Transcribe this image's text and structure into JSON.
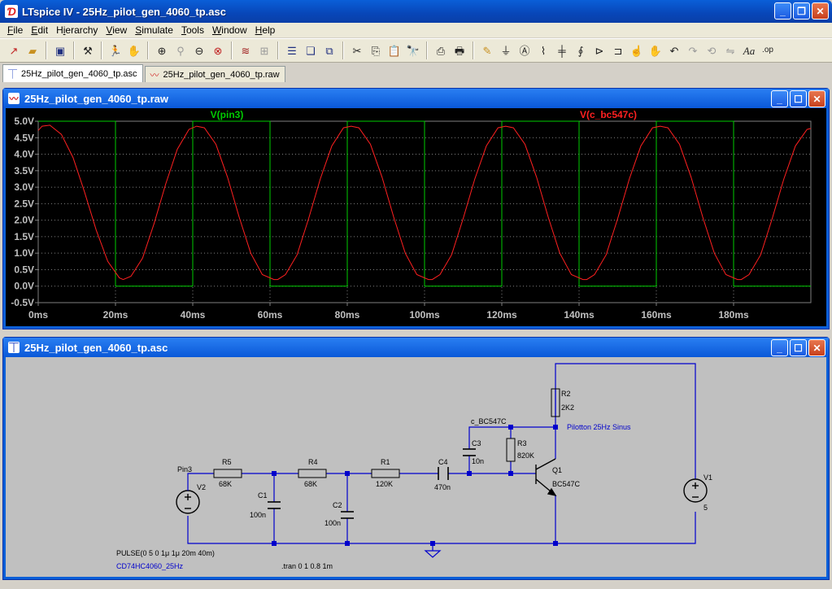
{
  "window": {
    "title": "LTspice IV - 25Hz_pilot_gen_4060_tp.asc",
    "icon": "ltspice-logo-icon"
  },
  "menu": [
    "File",
    "Edit",
    "Hierarchy",
    "View",
    "Simulate",
    "Tools",
    "Window",
    "Help"
  ],
  "toolbar": {
    "groups": [
      [
        "new-schematic-icon",
        "open-icon"
      ],
      [
        "save-icon"
      ],
      [
        "control-panel-icon"
      ],
      [
        "run-icon",
        "halt-icon"
      ],
      [
        "zoom-in-icon",
        "zoom-pan-icon",
        "zoom-out-icon",
        "zoom-fit-icon"
      ],
      [
        "autorange-icon",
        "grid-icon"
      ],
      [
        "tile-horizontal-icon",
        "cascade-icon",
        "tile-vertical-icon"
      ],
      [
        "cut-icon",
        "copy-icon",
        "paste-icon",
        "find-icon"
      ],
      [
        "print-setup-icon",
        "print-icon"
      ],
      [
        "wire-icon",
        "ground-icon",
        "label-icon",
        "resistor-icon",
        "capacitor-icon",
        "inductor-icon",
        "diode-icon",
        "component-icon",
        "move-icon",
        "drag-icon",
        "undo-icon",
        "redo-icon",
        "rotate-icon",
        "mirror-icon",
        "text-icon",
        "spice-directive-icon"
      ]
    ]
  },
  "tabs": [
    {
      "label": "25Hz_pilot_gen_4060_tp.asc",
      "icon": "schematic-icon",
      "active": true
    },
    {
      "label": "25Hz_pilot_gen_4060_tp.raw",
      "icon": "waveform-icon",
      "active": false
    }
  ],
  "wave_window": {
    "title": "25Hz_pilot_gen_4060_tp.raw"
  },
  "sch_window": {
    "title": "25Hz_pilot_gen_4060_tp.asc"
  },
  "chart_data": {
    "type": "line",
    "xlabel": "",
    "ylabel": "",
    "xlim": [
      0,
      200
    ],
    "ylim": [
      -0.5,
      5.0
    ],
    "x_ticks": [
      "0ms",
      "20ms",
      "40ms",
      "60ms",
      "80ms",
      "100ms",
      "120ms",
      "140ms",
      "160ms",
      "180ms"
    ],
    "x_tick_values": [
      0,
      20,
      40,
      60,
      80,
      100,
      120,
      140,
      160,
      180
    ],
    "y_ticks": [
      "5.0V",
      "4.5V",
      "4.0V",
      "3.5V",
      "3.0V",
      "2.5V",
      "2.0V",
      "1.5V",
      "1.0V",
      "0.5V",
      "0.0V",
      "-0.5V"
    ],
    "y_tick_values": [
      5.0,
      4.5,
      4.0,
      3.5,
      3.0,
      2.5,
      2.0,
      1.5,
      1.0,
      0.5,
      0.0,
      -0.5
    ],
    "grid": true,
    "background": "#000000",
    "grid_color": "#808080",
    "series": [
      {
        "name": "V(pin3)",
        "color": "#00cc00",
        "x": [
          0,
          20,
          20,
          40,
          40,
          60,
          60,
          80,
          80,
          100,
          100,
          120,
          120,
          140,
          140,
          160,
          160,
          180,
          180,
          200
        ],
        "y": [
          5,
          5,
          0,
          0,
          5,
          5,
          0,
          0,
          5,
          5,
          0,
          0,
          5,
          5,
          0,
          0,
          5,
          5,
          0,
          0
        ]
      },
      {
        "name": "V(c_bc547c)",
        "color": "#ff2020",
        "x": [
          0,
          1,
          3,
          6,
          9,
          12,
          15,
          18,
          21,
          22,
          24,
          27,
          30,
          33,
          36,
          39,
          41,
          43,
          46,
          49,
          52,
          55,
          58,
          61,
          62,
          64,
          67,
          70,
          73,
          76,
          79,
          81,
          83,
          86,
          89,
          92,
          95,
          98,
          101,
          102,
          104,
          107,
          110,
          113,
          116,
          119,
          121,
          123,
          126,
          129,
          132,
          135,
          138,
          141,
          142,
          144,
          147,
          150,
          153,
          156,
          159,
          161,
          163,
          166,
          169,
          172,
          175,
          178,
          181,
          182,
          184,
          187,
          190,
          193,
          196,
          199,
          200
        ],
        "y": [
          4.72,
          4.85,
          4.88,
          4.6,
          3.9,
          2.85,
          1.7,
          0.75,
          0.25,
          0.2,
          0.3,
          0.85,
          1.9,
          3.1,
          4.15,
          4.75,
          4.85,
          4.8,
          4.3,
          3.3,
          2.1,
          1.0,
          0.35,
          0.2,
          0.2,
          0.35,
          0.95,
          2.05,
          3.25,
          4.25,
          4.8,
          4.85,
          4.8,
          4.3,
          3.3,
          2.1,
          1.0,
          0.35,
          0.2,
          0.2,
          0.35,
          0.95,
          2.05,
          3.25,
          4.25,
          4.8,
          4.85,
          4.8,
          4.3,
          3.3,
          2.1,
          1.0,
          0.35,
          0.2,
          0.2,
          0.35,
          0.95,
          2.05,
          3.25,
          4.25,
          4.8,
          4.85,
          4.8,
          4.3,
          3.3,
          2.1,
          1.0,
          0.35,
          0.2,
          0.2,
          0.35,
          0.95,
          2.05,
          3.25,
          4.25,
          4.75,
          4.78
        ]
      }
    ]
  },
  "schematic": {
    "wire_color": "#0000cc",
    "flag_color": "#000000",
    "components": [
      {
        "ref": "R5",
        "value": "68K"
      },
      {
        "ref": "R4",
        "value": "68K"
      },
      {
        "ref": "R1",
        "value": "120K"
      },
      {
        "ref": "C4",
        "value": "470n"
      },
      {
        "ref": "C1",
        "value": "100n"
      },
      {
        "ref": "C2",
        "value": "100n"
      },
      {
        "ref": "C3",
        "value": "10n"
      },
      {
        "ref": "R3",
        "value": "820K"
      },
      {
        "ref": "R2",
        "value": "2K2"
      },
      {
        "ref": "Q1",
        "value": "BC547C"
      },
      {
        "ref": "V1",
        "value": "5"
      },
      {
        "ref": "V2",
        "value": "PULSE(0 5 0 1μ 1μ 20m 40m)"
      }
    ],
    "net_labels": {
      "pin3": "Pin3",
      "collector": "c_BC547C"
    },
    "comments": {
      "output": "Pilotton 25Hz Sinus",
      "source": "CD74HC4060_25Hz"
    },
    "directive": ".tran 0 1 0.8 1m"
  }
}
